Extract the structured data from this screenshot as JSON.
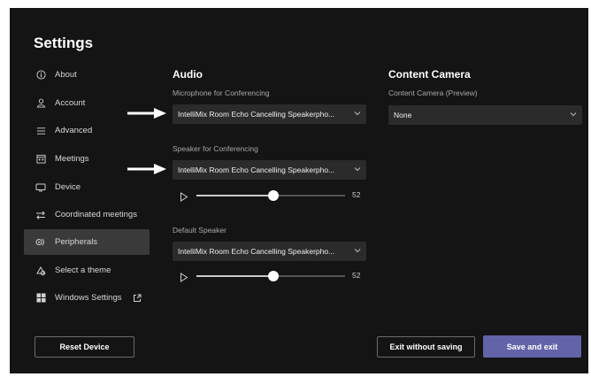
{
  "settings": {
    "title": "Settings"
  },
  "sidebar": {
    "items": [
      {
        "label": "About",
        "icon": "info-icon"
      },
      {
        "label": "Account",
        "icon": "person-icon"
      },
      {
        "label": "Advanced",
        "icon": "list-icon"
      },
      {
        "label": "Meetings",
        "icon": "calendar-icon"
      },
      {
        "label": "Device",
        "icon": "monitor-icon"
      },
      {
        "label": "Coordinated meetings",
        "icon": "swap-arrows-icon"
      },
      {
        "label": "Peripherals",
        "icon": "peripherals-icon",
        "active": true
      },
      {
        "label": "Select a theme",
        "icon": "palette-icon"
      },
      {
        "label": "Windows Settings",
        "icon": "windows-logo-icon",
        "trailing_icon": "external-link-icon"
      }
    ]
  },
  "audio": {
    "heading": "Audio",
    "microphone": {
      "label": "Microphone for Conferencing",
      "value": "IntelliMix Room Echo Cancelling Speakerpho..."
    },
    "speaker": {
      "label": "Speaker for Conferencing",
      "value": "IntelliMix Room Echo Cancelling Speakerpho...",
      "volume": "52",
      "volume_fraction": 0.52
    },
    "default_speaker": {
      "label": "Default Speaker",
      "value": "IntelliMix Room Echo Cancelling Speakerpho...",
      "volume": "52",
      "volume_fraction": 0.52
    }
  },
  "content_camera": {
    "heading": "Content Camera",
    "label": "Content Camera (Preview)",
    "value": "None"
  },
  "footer": {
    "reset_label": "Reset Device",
    "exit_label": "Exit without saving",
    "save_label": "Save and exit"
  },
  "colors": {
    "primary": "#6264a7",
    "background": "#141414",
    "select_bg": "#2b2b2b"
  }
}
